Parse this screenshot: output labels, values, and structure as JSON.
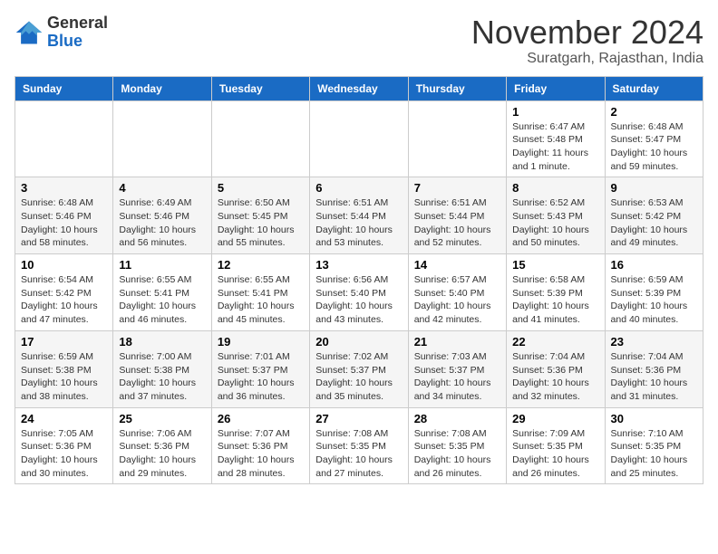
{
  "header": {
    "logo_general": "General",
    "logo_blue": "Blue",
    "month_title": "November 2024",
    "subtitle": "Suratgarh, Rajasthan, India"
  },
  "days_of_week": [
    "Sunday",
    "Monday",
    "Tuesday",
    "Wednesday",
    "Thursday",
    "Friday",
    "Saturday"
  ],
  "weeks": [
    [
      {
        "day": "",
        "info": ""
      },
      {
        "day": "",
        "info": ""
      },
      {
        "day": "",
        "info": ""
      },
      {
        "day": "",
        "info": ""
      },
      {
        "day": "",
        "info": ""
      },
      {
        "day": "1",
        "info": "Sunrise: 6:47 AM\nSunset: 5:48 PM\nDaylight: 11 hours and 1 minute."
      },
      {
        "day": "2",
        "info": "Sunrise: 6:48 AM\nSunset: 5:47 PM\nDaylight: 10 hours and 59 minutes."
      }
    ],
    [
      {
        "day": "3",
        "info": "Sunrise: 6:48 AM\nSunset: 5:46 PM\nDaylight: 10 hours and 58 minutes."
      },
      {
        "day": "4",
        "info": "Sunrise: 6:49 AM\nSunset: 5:46 PM\nDaylight: 10 hours and 56 minutes."
      },
      {
        "day": "5",
        "info": "Sunrise: 6:50 AM\nSunset: 5:45 PM\nDaylight: 10 hours and 55 minutes."
      },
      {
        "day": "6",
        "info": "Sunrise: 6:51 AM\nSunset: 5:44 PM\nDaylight: 10 hours and 53 minutes."
      },
      {
        "day": "7",
        "info": "Sunrise: 6:51 AM\nSunset: 5:44 PM\nDaylight: 10 hours and 52 minutes."
      },
      {
        "day": "8",
        "info": "Sunrise: 6:52 AM\nSunset: 5:43 PM\nDaylight: 10 hours and 50 minutes."
      },
      {
        "day": "9",
        "info": "Sunrise: 6:53 AM\nSunset: 5:42 PM\nDaylight: 10 hours and 49 minutes."
      }
    ],
    [
      {
        "day": "10",
        "info": "Sunrise: 6:54 AM\nSunset: 5:42 PM\nDaylight: 10 hours and 47 minutes."
      },
      {
        "day": "11",
        "info": "Sunrise: 6:55 AM\nSunset: 5:41 PM\nDaylight: 10 hours and 46 minutes."
      },
      {
        "day": "12",
        "info": "Sunrise: 6:55 AM\nSunset: 5:41 PM\nDaylight: 10 hours and 45 minutes."
      },
      {
        "day": "13",
        "info": "Sunrise: 6:56 AM\nSunset: 5:40 PM\nDaylight: 10 hours and 43 minutes."
      },
      {
        "day": "14",
        "info": "Sunrise: 6:57 AM\nSunset: 5:40 PM\nDaylight: 10 hours and 42 minutes."
      },
      {
        "day": "15",
        "info": "Sunrise: 6:58 AM\nSunset: 5:39 PM\nDaylight: 10 hours and 41 minutes."
      },
      {
        "day": "16",
        "info": "Sunrise: 6:59 AM\nSunset: 5:39 PM\nDaylight: 10 hours and 40 minutes."
      }
    ],
    [
      {
        "day": "17",
        "info": "Sunrise: 6:59 AM\nSunset: 5:38 PM\nDaylight: 10 hours and 38 minutes."
      },
      {
        "day": "18",
        "info": "Sunrise: 7:00 AM\nSunset: 5:38 PM\nDaylight: 10 hours and 37 minutes."
      },
      {
        "day": "19",
        "info": "Sunrise: 7:01 AM\nSunset: 5:37 PM\nDaylight: 10 hours and 36 minutes."
      },
      {
        "day": "20",
        "info": "Sunrise: 7:02 AM\nSunset: 5:37 PM\nDaylight: 10 hours and 35 minutes."
      },
      {
        "day": "21",
        "info": "Sunrise: 7:03 AM\nSunset: 5:37 PM\nDaylight: 10 hours and 34 minutes."
      },
      {
        "day": "22",
        "info": "Sunrise: 7:04 AM\nSunset: 5:36 PM\nDaylight: 10 hours and 32 minutes."
      },
      {
        "day": "23",
        "info": "Sunrise: 7:04 AM\nSunset: 5:36 PM\nDaylight: 10 hours and 31 minutes."
      }
    ],
    [
      {
        "day": "24",
        "info": "Sunrise: 7:05 AM\nSunset: 5:36 PM\nDaylight: 10 hours and 30 minutes."
      },
      {
        "day": "25",
        "info": "Sunrise: 7:06 AM\nSunset: 5:36 PM\nDaylight: 10 hours and 29 minutes."
      },
      {
        "day": "26",
        "info": "Sunrise: 7:07 AM\nSunset: 5:36 PM\nDaylight: 10 hours and 28 minutes."
      },
      {
        "day": "27",
        "info": "Sunrise: 7:08 AM\nSunset: 5:35 PM\nDaylight: 10 hours and 27 minutes."
      },
      {
        "day": "28",
        "info": "Sunrise: 7:08 AM\nSunset: 5:35 PM\nDaylight: 10 hours and 26 minutes."
      },
      {
        "day": "29",
        "info": "Sunrise: 7:09 AM\nSunset: 5:35 PM\nDaylight: 10 hours and 26 minutes."
      },
      {
        "day": "30",
        "info": "Sunrise: 7:10 AM\nSunset: 5:35 PM\nDaylight: 10 hours and 25 minutes."
      }
    ]
  ]
}
